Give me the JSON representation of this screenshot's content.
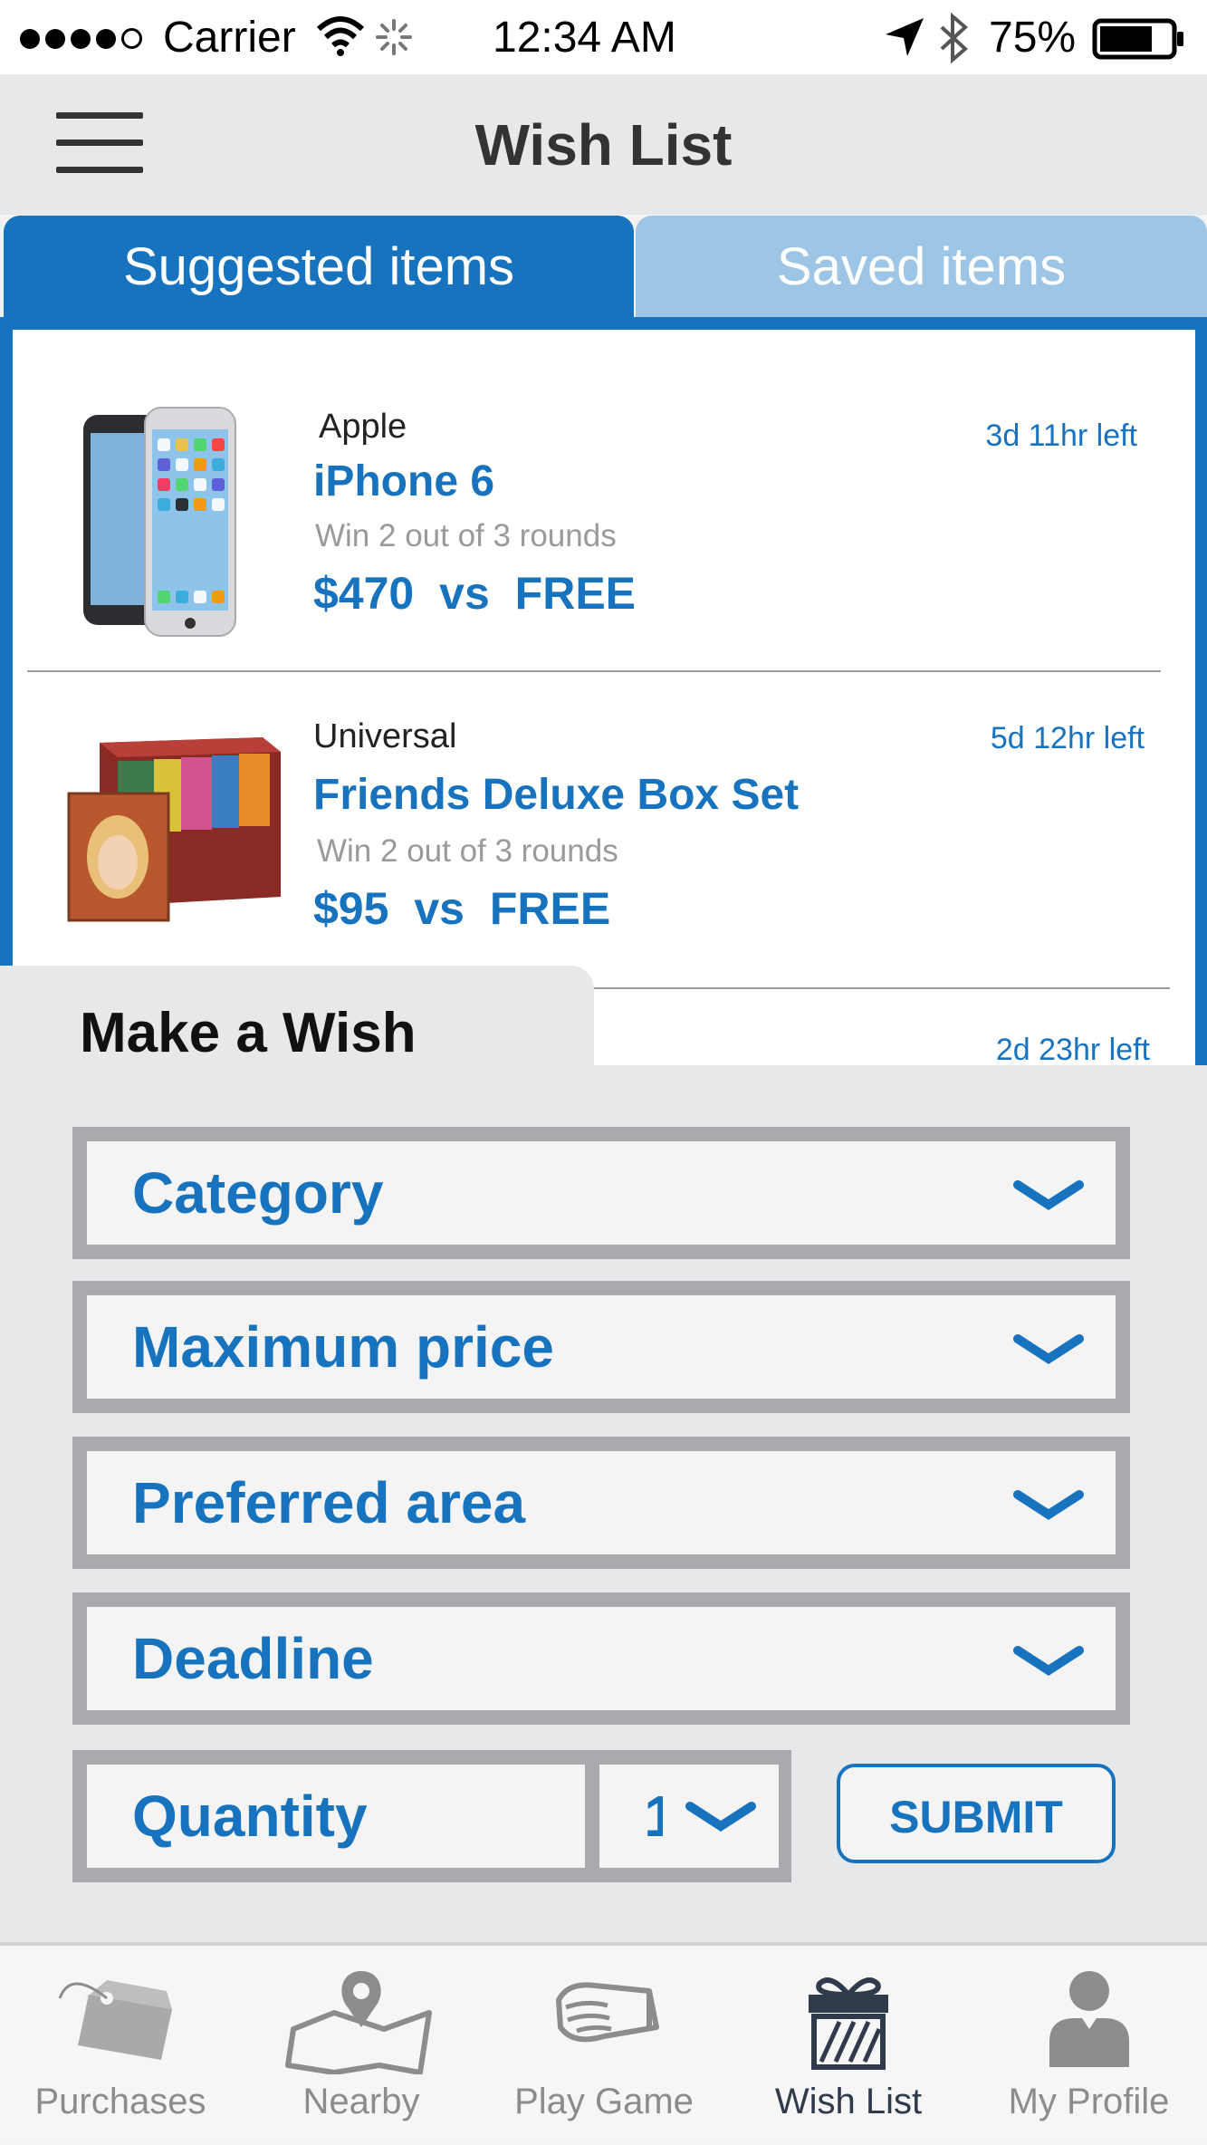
{
  "status_bar": {
    "carrier": "Carrier",
    "time": "12:34 AM",
    "battery": "75%",
    "battery_level": 0.75
  },
  "header": {
    "title": "Wish List"
  },
  "tabs": [
    {
      "label": "Suggested items",
      "active": true
    },
    {
      "label": "Saved items",
      "active": false
    }
  ],
  "items": [
    {
      "brand": "Apple",
      "name": "iPhone 6",
      "condition": "Win 2 out of 3 rounds",
      "price": "$470",
      "vs": "vs",
      "free": "FREE",
      "time_left": "3d 11hr left"
    },
    {
      "brand": "Universal",
      "name": "Friends Deluxe Box Set",
      "condition": "Win 2 out of 3 rounds",
      "price": "$95",
      "vs": "vs",
      "free": "FREE",
      "time_left": "5d 12hr left"
    },
    {
      "time_left": "2d 23hr left"
    }
  ],
  "wish": {
    "title": "Make a Wish",
    "fields": [
      "Category",
      "Maximum price",
      "Preferred area",
      "Deadline"
    ],
    "quantity_label": "Quantity",
    "quantity_value": "1",
    "submit_label": "SUBMIT"
  },
  "nav": {
    "items": [
      {
        "label": "Purchases",
        "icon": "tag-icon"
      },
      {
        "label": "Nearby",
        "icon": "map-pin-icon"
      },
      {
        "label": "Play Game",
        "icon": "fist-icon"
      },
      {
        "label": "Wish List",
        "icon": "gift-icon",
        "active": true
      },
      {
        "label": "My Profile",
        "icon": "user-icon"
      }
    ]
  },
  "colors": {
    "accent": "#1873bf",
    "tab_inactive": "#9dc6e6",
    "panel": "#e7e8ea"
  }
}
